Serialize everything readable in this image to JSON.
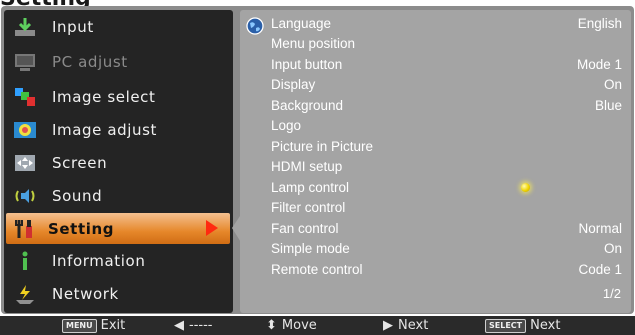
{
  "title": "Setting",
  "menu": {
    "items": [
      {
        "label": "Input",
        "icon": "input-icon",
        "state": "normal"
      },
      {
        "label": "PC adjust",
        "icon": "pc-adjust-icon",
        "state": "disabled"
      },
      {
        "label": "Image select",
        "icon": "image-select-icon",
        "state": "normal"
      },
      {
        "label": "Image adjust",
        "icon": "image-adjust-icon",
        "state": "normal"
      },
      {
        "label": "Screen",
        "icon": "screen-icon",
        "state": "normal"
      },
      {
        "label": "Sound",
        "icon": "sound-icon",
        "state": "normal"
      },
      {
        "label": "Setting",
        "icon": "setting-icon",
        "state": "selected"
      },
      {
        "label": "Information",
        "icon": "information-icon",
        "state": "normal"
      },
      {
        "label": "Network",
        "icon": "network-icon",
        "state": "normal"
      }
    ]
  },
  "settings": {
    "rows": [
      {
        "name": "Language",
        "value": "English"
      },
      {
        "name": "Menu position",
        "value": ""
      },
      {
        "name": "Input button",
        "value": "Mode 1"
      },
      {
        "name": "Display",
        "value": "On"
      },
      {
        "name": "Background",
        "value": "Blue"
      },
      {
        "name": "Logo",
        "value": ""
      },
      {
        "name": "Picture in Picture",
        "value": ""
      },
      {
        "name": "HDMI setup",
        "value": ""
      },
      {
        "name": "Lamp control",
        "value": ""
      },
      {
        "name": "Filter control",
        "value": ""
      },
      {
        "name": "Fan control",
        "value": "Normal"
      },
      {
        "name": "Simple mode",
        "value": "On"
      },
      {
        "name": "Remote control",
        "value": "Code 1"
      }
    ],
    "page_indicator": "1/2"
  },
  "statusbar": {
    "exit_key": "MENU",
    "exit_label": "Exit",
    "back_label": "-----",
    "move_label": "Move",
    "next_label": "Next",
    "select_key": "SELECT",
    "select_label": "Next"
  },
  "colors": {
    "menu_bg": "#242424",
    "panel_bg": "#a4a4a4",
    "selected_bg": "#e6872a",
    "selected_arrow": "#ff2a10",
    "lamp_indicator": "#f0d400"
  }
}
